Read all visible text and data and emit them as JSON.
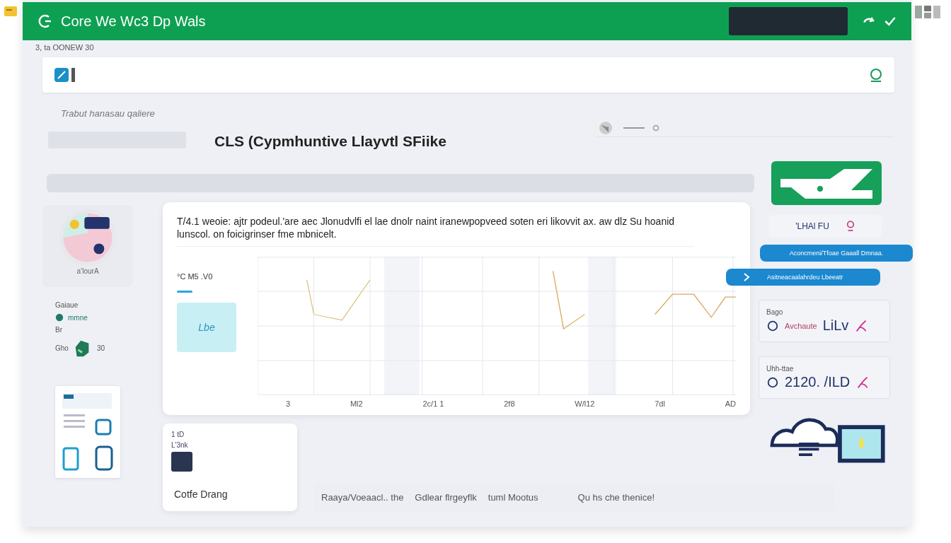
{
  "header": {
    "title": "Core We Wc3  Dp Wals"
  },
  "breadcrumb": "3, ta OONEW 30",
  "subtitle": "Trabut hanasau qaliere",
  "heading": "CLS (Cypmhuntive Llayvtl SFiike",
  "avatar_caption": "aʻlourA",
  "side_labels": [
    "Gaiaue",
    "mmne",
    "Br",
    "Gho",
    "30"
  ],
  "card": {
    "description": "T/4.1 weoie: ajtr podeul.'are  aec Jlonudvlfi el lae dnolr naint iranewpopveed soten eri likovvit ax. aw dlz Su hoanid lunscol. on foicigrinser fme mbnicelt.",
    "reading": "°C M5 .V0",
    "tile_label": "Lbe",
    "x_labels": [
      "3",
      "Ml2",
      "2c/1 1",
      "2f8",
      "W/l12",
      "7dl",
      "AD"
    ]
  },
  "preview": {
    "labels": [
      "1 tD",
      "L'3nk"
    ],
    "title": "Cotfe Drang"
  },
  "footer": [
    "Raaya/Voeaacl.. the",
    "Gdlear flrgeyflk",
    "tuml Mootus",
    "Qu hs che thenice!"
  ],
  "right_panel": {
    "badge": "'LHAl FU",
    "pills": [
      {
        "label": "Aconcmeni/Tfoae Gaaall Dmnaa.",
        "kind": "plain"
      },
      {
        "label": "Asitneacaalahrdeu Lbeeatr",
        "kind": "arrow"
      }
    ],
    "cards": [
      {
        "caption": "Bago",
        "label": "Avchaute",
        "value": "LiLv"
      },
      {
        "caption": "Uhh-ttae",
        "value": "2120. /ILD"
      }
    ]
  }
}
